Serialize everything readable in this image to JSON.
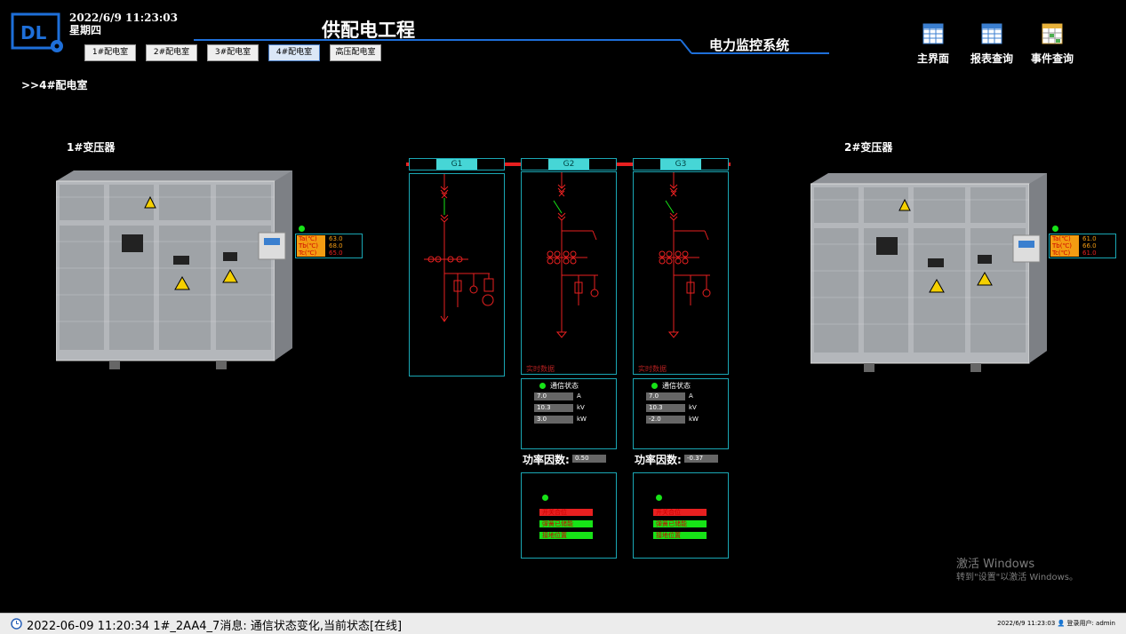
{
  "header": {
    "datetime": "2022/6/9 11:23:03",
    "weekday": "星期四",
    "title": "供配电工程",
    "subtitle": "电力监控系统",
    "rooms": [
      "1#配电室",
      "2#配电室",
      "3#配电室",
      "4#配电室",
      "高压配电室"
    ],
    "active_room": "4#配电室",
    "nav": [
      "主界面",
      "报表查询",
      "事件查询"
    ]
  },
  "breadcrumb": ">>4#配电室",
  "transformers": [
    {
      "label": "1#变压器",
      "temps": [
        {
          "k": "Ta(℃)",
          "v": "63.0"
        },
        {
          "k": "Tb(℃)",
          "v": "68.0"
        },
        {
          "k": "Tc(℃)",
          "v": "65.0"
        }
      ]
    },
    {
      "label": "2#变压器",
      "temps": [
        {
          "k": "Ta(℃)",
          "v": "61.0"
        },
        {
          "k": "Tb(℃)",
          "v": "66.0"
        },
        {
          "k": "Tc(℃)",
          "v": "61.0"
        }
      ]
    }
  ],
  "cabinets": [
    {
      "id": "G1"
    },
    {
      "id": "G2",
      "rt_label": "实时数据",
      "comm_label": "通信状态",
      "values": [
        {
          "v": "7.0",
          "u": "A"
        },
        {
          "v": "10.3",
          "u": "kV"
        },
        {
          "v": "3.0",
          "u": "kW"
        }
      ],
      "pf_label": "功率因数:",
      "pf": "0.50",
      "signals": [
        "开关合位",
        "弹簧已储能",
        "接地位置"
      ]
    },
    {
      "id": "G3",
      "rt_label": "实时数据",
      "comm_label": "通信状态",
      "values": [
        {
          "v": "7.0",
          "u": "A"
        },
        {
          "v": "10.3",
          "u": "kV"
        },
        {
          "v": "-2.0",
          "u": "kW"
        }
      ],
      "pf_label": "功率因数:",
      "pf": "-0.37",
      "signals": [
        "开关合位",
        "弹簧已储能",
        "接地位置"
      ]
    }
  ],
  "colors": {
    "accent": "#1e6fd9",
    "bus": "#e82020",
    "cyan": "#46d6d6",
    "ok": "#17e317",
    "alarm": "#e82020"
  },
  "watermark": {
    "line1": "激活 Windows",
    "line2": "转到\"设置\"以激活 Windows。"
  },
  "statusbar": {
    "message": "2022-06-09 11:20:34  1#_2AA4_7消息:   通信状态变化,当前状态[在线]",
    "right": "2022/6/9 11:23:03",
    "user_label": "登录用户: admin"
  }
}
